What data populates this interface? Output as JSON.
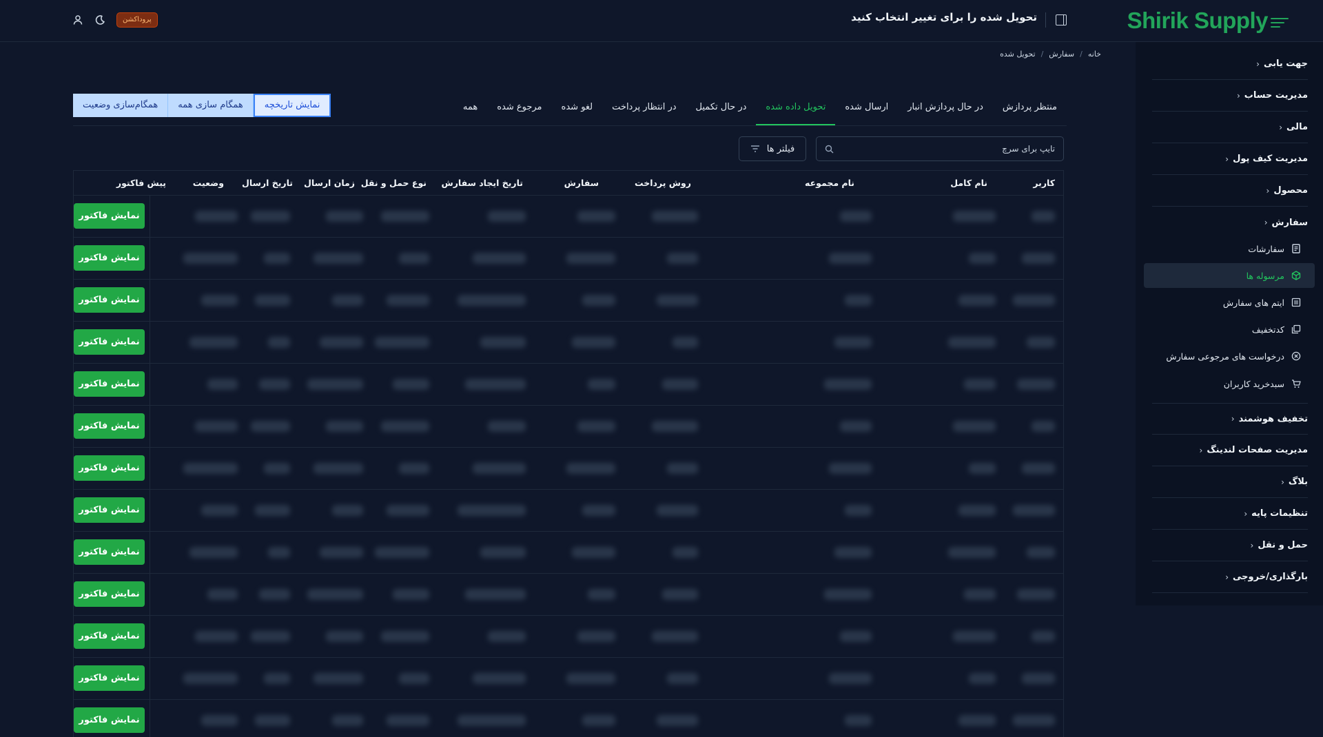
{
  "brand": {
    "name": "Shirik Supply",
    "color": "#22a55a"
  },
  "header": {
    "title": "تحویل شده را برای تغییر انتخاب کنید",
    "env_badge": "پروداکشن",
    "icons": [
      "sidebar-toggle-icon",
      "moon-icon",
      "user-icon"
    ]
  },
  "sidebar": {
    "groups_top": [
      {
        "label": "جهت یابی"
      },
      {
        "label": "مدیریت حساب"
      },
      {
        "label": "مالی"
      },
      {
        "label": "مدیریت کیف پول"
      },
      {
        "label": "محصول"
      },
      {
        "label": "سفارش"
      }
    ],
    "order_items": [
      {
        "label": "سفارشات",
        "icon": "receipt-icon"
      },
      {
        "label": "مرسوله ها",
        "icon": "package-icon",
        "active": true
      },
      {
        "label": "ایتم های سفارش",
        "icon": "list-icon"
      },
      {
        "label": "کدتخفیف",
        "icon": "coupon-icon"
      },
      {
        "label": "درخواست های مرجوعی سفارش",
        "icon": "cancel-circle-icon"
      },
      {
        "label": "سبدخرید کاربران",
        "icon": "cart-icon"
      }
    ],
    "groups_bottom": [
      {
        "label": "تخفیف هوشمند"
      },
      {
        "label": "مدیریت صفحات لندینگ"
      },
      {
        "label": "بلاگ"
      },
      {
        "label": "تنظیمات پایه"
      },
      {
        "label": "حمل و نقل"
      },
      {
        "label": "بارگذاری/خروجی"
      }
    ]
  },
  "breadcrumb": [
    "خانه",
    "سفارش",
    "تحویل شده"
  ],
  "tabs": [
    {
      "label": "منتظر پردازش"
    },
    {
      "label": "در حال پردازش انبار"
    },
    {
      "label": "ارسال شده"
    },
    {
      "label": "تحویل داده شده",
      "active": true
    },
    {
      "label": "در حال تکمیل"
    },
    {
      "label": "در انتظار پرداخت"
    },
    {
      "label": "لغو شده"
    },
    {
      "label": "مرجوع شده"
    },
    {
      "label": "همه"
    }
  ],
  "actions": {
    "history": "نمایش تاریخچه",
    "sync_all": "همگام سازی همه",
    "sync_status": "همگام‌سازی وضعیت"
  },
  "search": {
    "placeholder": "تایپ برای سرچ"
  },
  "filters": {
    "label": "فیلتر ها"
  },
  "table": {
    "columns": [
      "کاربر",
      "نام کامل",
      "نام مجموعه",
      "روش پرداخت",
      "سفارش",
      "تاریخ ایجاد سفارش",
      "نوع حمل و نقل",
      "زمان ارسال",
      "تاریخ ارسال",
      "وضعیت",
      "پیش فاکتور"
    ],
    "row_action": "نمایش فاکتور",
    "row_count": 13
  },
  "colors": {
    "accent": "#22c55e",
    "button": "#22a846",
    "bg": "#0f172a",
    "badge": "#7c2d12"
  }
}
